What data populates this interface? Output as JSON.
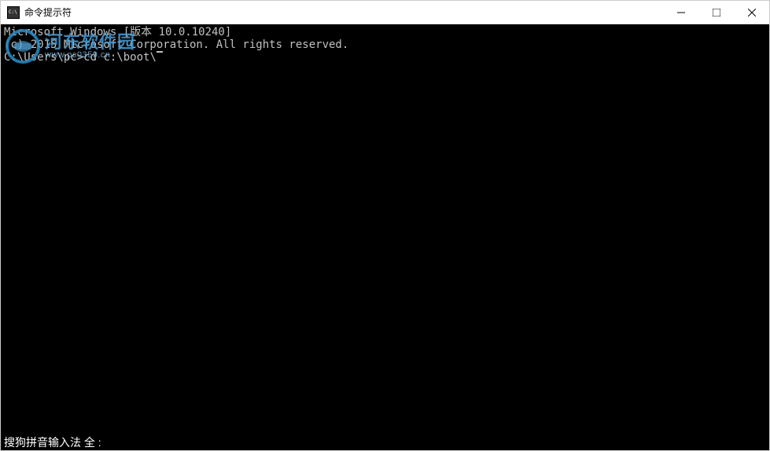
{
  "window": {
    "title": "命令提示符"
  },
  "terminal": {
    "line1": "Microsoft Windows [版本 10.0.10240]",
    "line2": "(c) 2015 Microsoft Corporation. All rights reserved.",
    "blank1": "",
    "prompt": "C:\\Users\\pc>",
    "input": "cd c:\\boot\\"
  },
  "ime": {
    "status": "搜狗拼音输入法 全 :"
  },
  "watermark": {
    "name": "河东软件园",
    "url": "www.pc0359.cn"
  }
}
